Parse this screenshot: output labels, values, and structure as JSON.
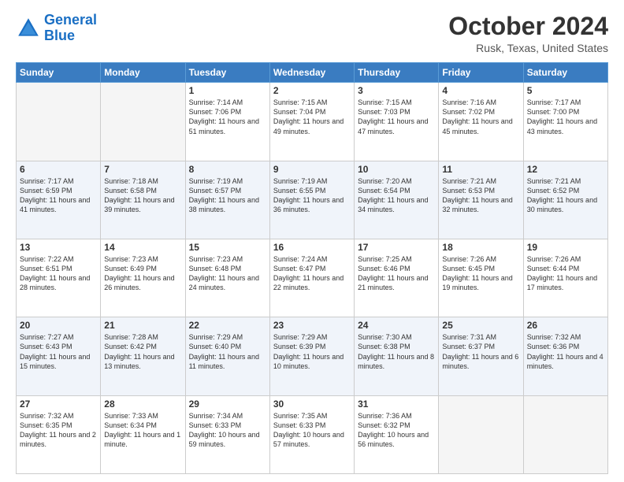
{
  "header": {
    "logo_line1": "General",
    "logo_line2": "Blue",
    "title": "October 2024",
    "subtitle": "Rusk, Texas, United States"
  },
  "days_of_week": [
    "Sunday",
    "Monday",
    "Tuesday",
    "Wednesday",
    "Thursday",
    "Friday",
    "Saturday"
  ],
  "weeks": [
    [
      {
        "day": "",
        "sunrise": "",
        "sunset": "",
        "daylight": ""
      },
      {
        "day": "",
        "sunrise": "",
        "sunset": "",
        "daylight": ""
      },
      {
        "day": "1",
        "sunrise": "Sunrise: 7:14 AM",
        "sunset": "Sunset: 7:06 PM",
        "daylight": "Daylight: 11 hours and 51 minutes."
      },
      {
        "day": "2",
        "sunrise": "Sunrise: 7:15 AM",
        "sunset": "Sunset: 7:04 PM",
        "daylight": "Daylight: 11 hours and 49 minutes."
      },
      {
        "day": "3",
        "sunrise": "Sunrise: 7:15 AM",
        "sunset": "Sunset: 7:03 PM",
        "daylight": "Daylight: 11 hours and 47 minutes."
      },
      {
        "day": "4",
        "sunrise": "Sunrise: 7:16 AM",
        "sunset": "Sunset: 7:02 PM",
        "daylight": "Daylight: 11 hours and 45 minutes."
      },
      {
        "day": "5",
        "sunrise": "Sunrise: 7:17 AM",
        "sunset": "Sunset: 7:00 PM",
        "daylight": "Daylight: 11 hours and 43 minutes."
      }
    ],
    [
      {
        "day": "6",
        "sunrise": "Sunrise: 7:17 AM",
        "sunset": "Sunset: 6:59 PM",
        "daylight": "Daylight: 11 hours and 41 minutes."
      },
      {
        "day": "7",
        "sunrise": "Sunrise: 7:18 AM",
        "sunset": "Sunset: 6:58 PM",
        "daylight": "Daylight: 11 hours and 39 minutes."
      },
      {
        "day": "8",
        "sunrise": "Sunrise: 7:19 AM",
        "sunset": "Sunset: 6:57 PM",
        "daylight": "Daylight: 11 hours and 38 minutes."
      },
      {
        "day": "9",
        "sunrise": "Sunrise: 7:19 AM",
        "sunset": "Sunset: 6:55 PM",
        "daylight": "Daylight: 11 hours and 36 minutes."
      },
      {
        "day": "10",
        "sunrise": "Sunrise: 7:20 AM",
        "sunset": "Sunset: 6:54 PM",
        "daylight": "Daylight: 11 hours and 34 minutes."
      },
      {
        "day": "11",
        "sunrise": "Sunrise: 7:21 AM",
        "sunset": "Sunset: 6:53 PM",
        "daylight": "Daylight: 11 hours and 32 minutes."
      },
      {
        "day": "12",
        "sunrise": "Sunrise: 7:21 AM",
        "sunset": "Sunset: 6:52 PM",
        "daylight": "Daylight: 11 hours and 30 minutes."
      }
    ],
    [
      {
        "day": "13",
        "sunrise": "Sunrise: 7:22 AM",
        "sunset": "Sunset: 6:51 PM",
        "daylight": "Daylight: 11 hours and 28 minutes."
      },
      {
        "day": "14",
        "sunrise": "Sunrise: 7:23 AM",
        "sunset": "Sunset: 6:49 PM",
        "daylight": "Daylight: 11 hours and 26 minutes."
      },
      {
        "day": "15",
        "sunrise": "Sunrise: 7:23 AM",
        "sunset": "Sunset: 6:48 PM",
        "daylight": "Daylight: 11 hours and 24 minutes."
      },
      {
        "day": "16",
        "sunrise": "Sunrise: 7:24 AM",
        "sunset": "Sunset: 6:47 PM",
        "daylight": "Daylight: 11 hours and 22 minutes."
      },
      {
        "day": "17",
        "sunrise": "Sunrise: 7:25 AM",
        "sunset": "Sunset: 6:46 PM",
        "daylight": "Daylight: 11 hours and 21 minutes."
      },
      {
        "day": "18",
        "sunrise": "Sunrise: 7:26 AM",
        "sunset": "Sunset: 6:45 PM",
        "daylight": "Daylight: 11 hours and 19 minutes."
      },
      {
        "day": "19",
        "sunrise": "Sunrise: 7:26 AM",
        "sunset": "Sunset: 6:44 PM",
        "daylight": "Daylight: 11 hours and 17 minutes."
      }
    ],
    [
      {
        "day": "20",
        "sunrise": "Sunrise: 7:27 AM",
        "sunset": "Sunset: 6:43 PM",
        "daylight": "Daylight: 11 hours and 15 minutes."
      },
      {
        "day": "21",
        "sunrise": "Sunrise: 7:28 AM",
        "sunset": "Sunset: 6:42 PM",
        "daylight": "Daylight: 11 hours and 13 minutes."
      },
      {
        "day": "22",
        "sunrise": "Sunrise: 7:29 AM",
        "sunset": "Sunset: 6:40 PM",
        "daylight": "Daylight: 11 hours and 11 minutes."
      },
      {
        "day": "23",
        "sunrise": "Sunrise: 7:29 AM",
        "sunset": "Sunset: 6:39 PM",
        "daylight": "Daylight: 11 hours and 10 minutes."
      },
      {
        "day": "24",
        "sunrise": "Sunrise: 7:30 AM",
        "sunset": "Sunset: 6:38 PM",
        "daylight": "Daylight: 11 hours and 8 minutes."
      },
      {
        "day": "25",
        "sunrise": "Sunrise: 7:31 AM",
        "sunset": "Sunset: 6:37 PM",
        "daylight": "Daylight: 11 hours and 6 minutes."
      },
      {
        "day": "26",
        "sunrise": "Sunrise: 7:32 AM",
        "sunset": "Sunset: 6:36 PM",
        "daylight": "Daylight: 11 hours and 4 minutes."
      }
    ],
    [
      {
        "day": "27",
        "sunrise": "Sunrise: 7:32 AM",
        "sunset": "Sunset: 6:35 PM",
        "daylight": "Daylight: 11 hours and 2 minutes."
      },
      {
        "day": "28",
        "sunrise": "Sunrise: 7:33 AM",
        "sunset": "Sunset: 6:34 PM",
        "daylight": "Daylight: 11 hours and 1 minute."
      },
      {
        "day": "29",
        "sunrise": "Sunrise: 7:34 AM",
        "sunset": "Sunset: 6:33 PM",
        "daylight": "Daylight: 10 hours and 59 minutes."
      },
      {
        "day": "30",
        "sunrise": "Sunrise: 7:35 AM",
        "sunset": "Sunset: 6:33 PM",
        "daylight": "Daylight: 10 hours and 57 minutes."
      },
      {
        "day": "31",
        "sunrise": "Sunrise: 7:36 AM",
        "sunset": "Sunset: 6:32 PM",
        "daylight": "Daylight: 10 hours and 56 minutes."
      },
      {
        "day": "",
        "sunrise": "",
        "sunset": "",
        "daylight": ""
      },
      {
        "day": "",
        "sunrise": "",
        "sunset": "",
        "daylight": ""
      }
    ]
  ]
}
